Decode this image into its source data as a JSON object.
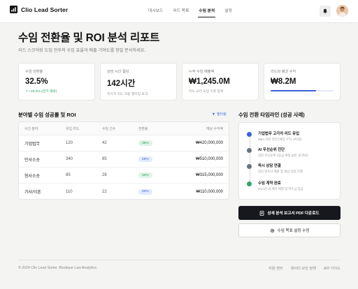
{
  "header": {
    "logo_text": "Clio Lead Sorter",
    "nav": [
      {
        "label": "대시보드",
        "active": false
      },
      {
        "label": "리드 목록",
        "active": false
      },
      {
        "label": "수임 분석",
        "active": true
      },
      {
        "label": "설정",
        "active": false
      }
    ]
  },
  "page": {
    "title": "수임 전환율 및 ROI 분석 리포트",
    "subtitle": "리드 스코어링 도입 전후의 수임 효율과 매출 기여도를 정밀 분석하세요."
  },
  "kpis": [
    {
      "label": "수임 전환율",
      "value": "32.5%",
      "note": "↗ +25.4% (전기 대비)",
      "note_color": "#1f9a57"
    },
    {
      "label": "상담 시간 절감",
      "value": "142시간",
      "note": "저가치 리드 자동 필터링 효과"
    },
    {
      "label": "누적 수임 매출액",
      "value": "₩1,245.0M",
      "note": "리드 소터 도입 이후 합계"
    },
    {
      "label": "리드당 평균 수익",
      "value": "₩8.2M",
      "progress": 0.72
    }
  ],
  "table": {
    "title": "분야별 수임 성공률 및 ROI",
    "filter_label": "필터링",
    "headers": [
      "사건 분야",
      "유입 리드",
      "수임 건수",
      "전환율",
      "예상 수익액"
    ],
    "rows": [
      {
        "area": "기업법무",
        "leads": "120",
        "cases": "42",
        "rate": "35%",
        "revenue": "₩420,000,000",
        "pill_bg": "#dff3e6",
        "pill_fg": "#2b9b58"
      },
      {
        "area": "민사소송",
        "leads": "340",
        "cases": "85",
        "rate": "25%",
        "revenue": "₩510,000,000",
        "pill_bg": "#e2eafb",
        "pill_fg": "#3a62d8"
      },
      {
        "area": "형사소송",
        "leads": "85",
        "cases": "28",
        "rate": "33%",
        "revenue": "₩315,000,000",
        "pill_bg": "#dff3e6",
        "pill_fg": "#2b9b58"
      },
      {
        "area": "가사/이혼",
        "leads": "110",
        "cases": "22",
        "rate": "20%",
        "revenue": "₩110,000,000",
        "pill_bg": "#e2eafb",
        "pill_fg": "#3a62d8"
      }
    ]
  },
  "timeline": {
    "title": "수임 전환 타임라인 (성공 사례)",
    "items": [
      {
        "title": "기업법무 고가치 리드 유입",
        "desc": "M&A 자문 관련 (예상 수익: 8억원)",
        "color": "#3a62d8"
      },
      {
        "title": "AI 우선순위 진단",
        "desc": "상담 우선순위 1등급 배정 (5분 내 완료)",
        "color": "#6b7280"
      },
      {
        "title": "즉시 상담 연결",
        "desc": "담당 변호사 배정 및 화상 상담 진행",
        "color": "#6b7280"
      },
      {
        "title": "수임 계약 완료",
        "desc": "24시간 내 계약 체결 및 착수금 입금",
        "color": "#2fa66a"
      }
    ]
  },
  "actions": {
    "download_label": "상세 분석 보고서 PDF 다운로드",
    "settings_label": "수임 목표 설정 수정"
  },
  "footer": {
    "copyright": "© 2024 Clio Lead Sorter. Boutique Law Analytics.",
    "links": [
      "지원 센터",
      "데이터 보안 정책",
      "API 가이드"
    ]
  }
}
